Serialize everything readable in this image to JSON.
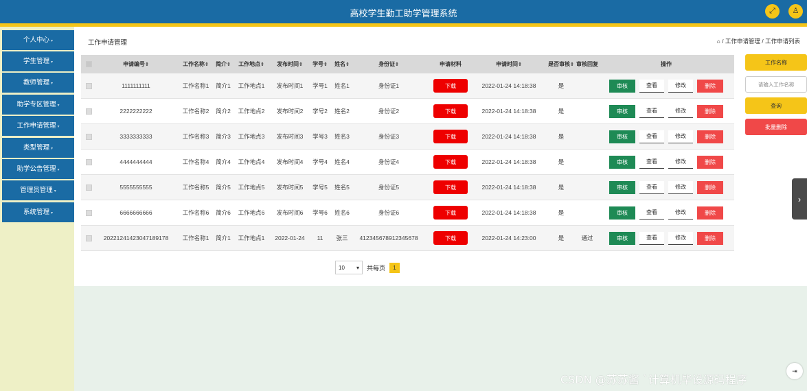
{
  "app": {
    "title": "高校学生勤工助学管理系统",
    "fullscreen_icon": "expand-icon",
    "user_icon": "user-icon"
  },
  "colors": {
    "primary": "#1a6ba4",
    "accent": "#f5c518",
    "danger": "#f04848",
    "download": "#e00000",
    "review": "#1e8a55"
  },
  "sidebar": {
    "items": [
      {
        "label": "个人中心"
      },
      {
        "label": "学生管理"
      },
      {
        "label": "教师管理"
      },
      {
        "label": "助学专区管理"
      },
      {
        "label": "工作申请管理"
      },
      {
        "label": "类型管理"
      },
      {
        "label": "助学公告管理"
      },
      {
        "label": "管理员管理"
      },
      {
        "label": "系统管理"
      }
    ]
  },
  "page": {
    "title": "工作申请管理",
    "breadcrumb": "工作申请管理 / 工作申请列表",
    "home_icon": "home-icon"
  },
  "table": {
    "headers": [
      "申请编号",
      "工作名称",
      "简介",
      "工作地点",
      "发布时间",
      "学号",
      "姓名",
      "身份证",
      "申请材料",
      "申请时间",
      "是否审核",
      "审核回复",
      "操作"
    ],
    "sortable_mark": "⇕",
    "download_label": "下载",
    "actions": {
      "review": "审核",
      "view": "查看",
      "edit": "修改",
      "delete": "删除"
    },
    "rows": [
      {
        "id": "1111111111",
        "job": "工作名称1",
        "intro": "简介1",
        "place": "工作地点1",
        "pub": "发布时间1",
        "sno": "学号1",
        "name": "姓名1",
        "idcard": "身份证1",
        "time": "2022-01-24 14:18:38",
        "reviewed": "是",
        "reply": ""
      },
      {
        "id": "2222222222",
        "job": "工作名称2",
        "intro": "简介2",
        "place": "工作地点2",
        "pub": "发布时间2",
        "sno": "学号2",
        "name": "姓名2",
        "idcard": "身份证2",
        "time": "2022-01-24 14:18:38",
        "reviewed": "是",
        "reply": ""
      },
      {
        "id": "3333333333",
        "job": "工作名称3",
        "intro": "简介3",
        "place": "工作地点3",
        "pub": "发布时间3",
        "sno": "学号3",
        "name": "姓名3",
        "idcard": "身份证3",
        "time": "2022-01-24 14:18:38",
        "reviewed": "是",
        "reply": ""
      },
      {
        "id": "4444444444",
        "job": "工作名称4",
        "intro": "简介4",
        "place": "工作地点4",
        "pub": "发布时间4",
        "sno": "学号4",
        "name": "姓名4",
        "idcard": "身份证4",
        "time": "2022-01-24 14:18:38",
        "reviewed": "是",
        "reply": ""
      },
      {
        "id": "5555555555",
        "job": "工作名称5",
        "intro": "简介5",
        "place": "工作地点5",
        "pub": "发布时间5",
        "sno": "学号5",
        "name": "姓名5",
        "idcard": "身份证5",
        "time": "2022-01-24 14:18:38",
        "reviewed": "是",
        "reply": ""
      },
      {
        "id": "6666666666",
        "job": "工作名称6",
        "intro": "简介6",
        "place": "工作地点6",
        "pub": "发布时间6",
        "sno": "学号6",
        "name": "姓名6",
        "idcard": "身份证6",
        "time": "2022-01-24 14:18:38",
        "reviewed": "是",
        "reply": ""
      },
      {
        "id": "20221241423047189178",
        "job": "工作名称1",
        "intro": "简介1",
        "place": "工作地点1",
        "pub": "2022-01-24",
        "sno": "11",
        "name": "张三",
        "idcard": "412345678912345678",
        "time": "2022-01-24 14:23:00",
        "reviewed": "是",
        "reply": "通过"
      }
    ]
  },
  "pagination": {
    "page_size": "10",
    "total_label": "共每页",
    "current_page": "1"
  },
  "search": {
    "field_label": "工作名称",
    "placeholder": "请输入工作名称",
    "query_label": "查询",
    "batch_delete_label": "批量删除"
  },
  "watermark": "CSDN @苏苏酱 `计算机毕设源码程序"
}
